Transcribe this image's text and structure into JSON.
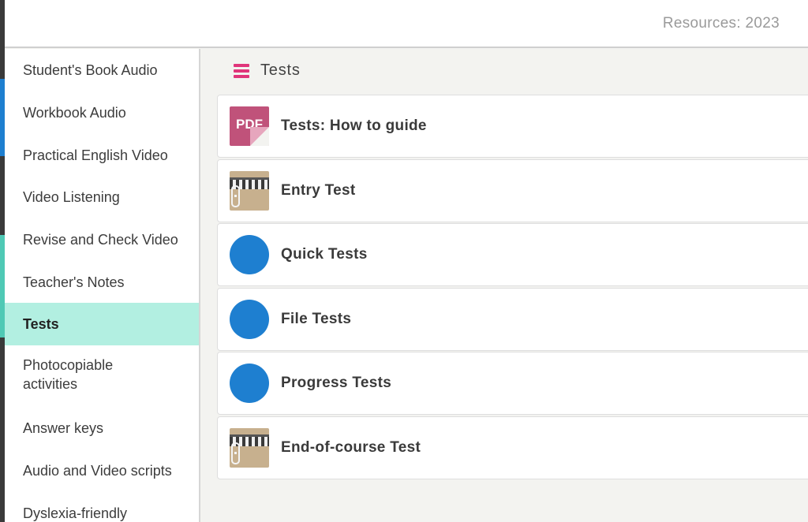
{
  "header": {
    "resources_label": "Resources: 2023"
  },
  "sidebar": {
    "items": [
      {
        "label": "Student's Book Audio"
      },
      {
        "label": "Workbook Audio"
      },
      {
        "label": "Practical English Video"
      },
      {
        "label": "Video Listening"
      },
      {
        "label": "Revise and Check Video"
      },
      {
        "label": "Teacher's Notes"
      },
      {
        "label": "Tests",
        "active": true
      },
      {
        "label": "Photocopiable activities"
      },
      {
        "label": "Answer keys"
      },
      {
        "label": "Audio and Video scripts"
      },
      {
        "label": "Dyslexia-friendly"
      }
    ]
  },
  "main": {
    "section_title": "Tests",
    "items": [
      {
        "label": "Tests: How to guide",
        "icon": "pdf-file-icon",
        "badge": "PDF"
      },
      {
        "label": "Entry Test",
        "icon": "zip-archive-icon"
      },
      {
        "label": "Quick Tests",
        "icon": "folder-circle-icon"
      },
      {
        "label": "File Tests",
        "icon": "folder-circle-icon"
      },
      {
        "label": "Progress Tests",
        "icon": "folder-circle-icon"
      },
      {
        "label": "End-of-course Test",
        "icon": "zip-archive-icon"
      }
    ]
  },
  "colors": {
    "accent_pink": "#e0357a",
    "active_teal": "#b2efe1",
    "circle_blue": "#1e7fd0",
    "pdf_pink": "#c0527a",
    "zip_tan": "#c7b08e"
  }
}
